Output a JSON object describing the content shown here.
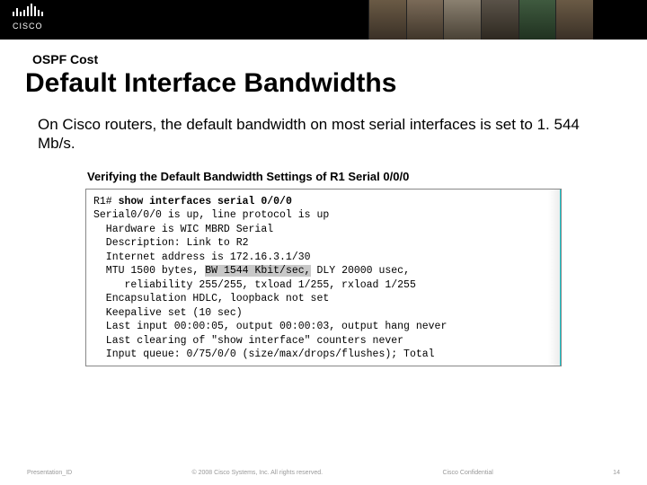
{
  "header": {
    "brand": "CISCO"
  },
  "kicker": "OSPF Cost",
  "title": "Default Interface Bandwidths",
  "body": "On Cisco routers, the default bandwidth on most serial interfaces is set to 1. 544 Mb/s.",
  "terminal": {
    "heading": "Verifying the Default Bandwidth Settings of R1 Serial 0/0/0",
    "prompt": "R1# ",
    "command": "show interfaces serial 0/0/0",
    "line1": "Serial0/0/0 is up, line protocol is up",
    "line2": "  Hardware is WIC MBRD Serial",
    "line3": "  Description: Link to R2",
    "line4": "  Internet address is 172.16.3.1/30",
    "line5a": "  MTU 1500 bytes, ",
    "line5_hl": "BW 1544 Kbit/sec,",
    "line5b": " DLY 20000 usec,",
    "line6": "     reliability 255/255, txload 1/255, rxload 1/255",
    "line7": "  Encapsulation HDLC, loopback not set",
    "line8": "  Keepalive set (10 sec)",
    "line9": "  Last input 00:00:05, output 00:00:03, output hang never",
    "line10": "  Last clearing of \"show interface\" counters never",
    "line11": "  Input queue: 0/75/0/0 (size/max/drops/flushes); Total"
  },
  "footer": {
    "left": "Presentation_ID",
    "center": "© 2008 Cisco Systems, Inc. All rights reserved.",
    "right_a": "Cisco Confidential",
    "right_b": "14"
  }
}
